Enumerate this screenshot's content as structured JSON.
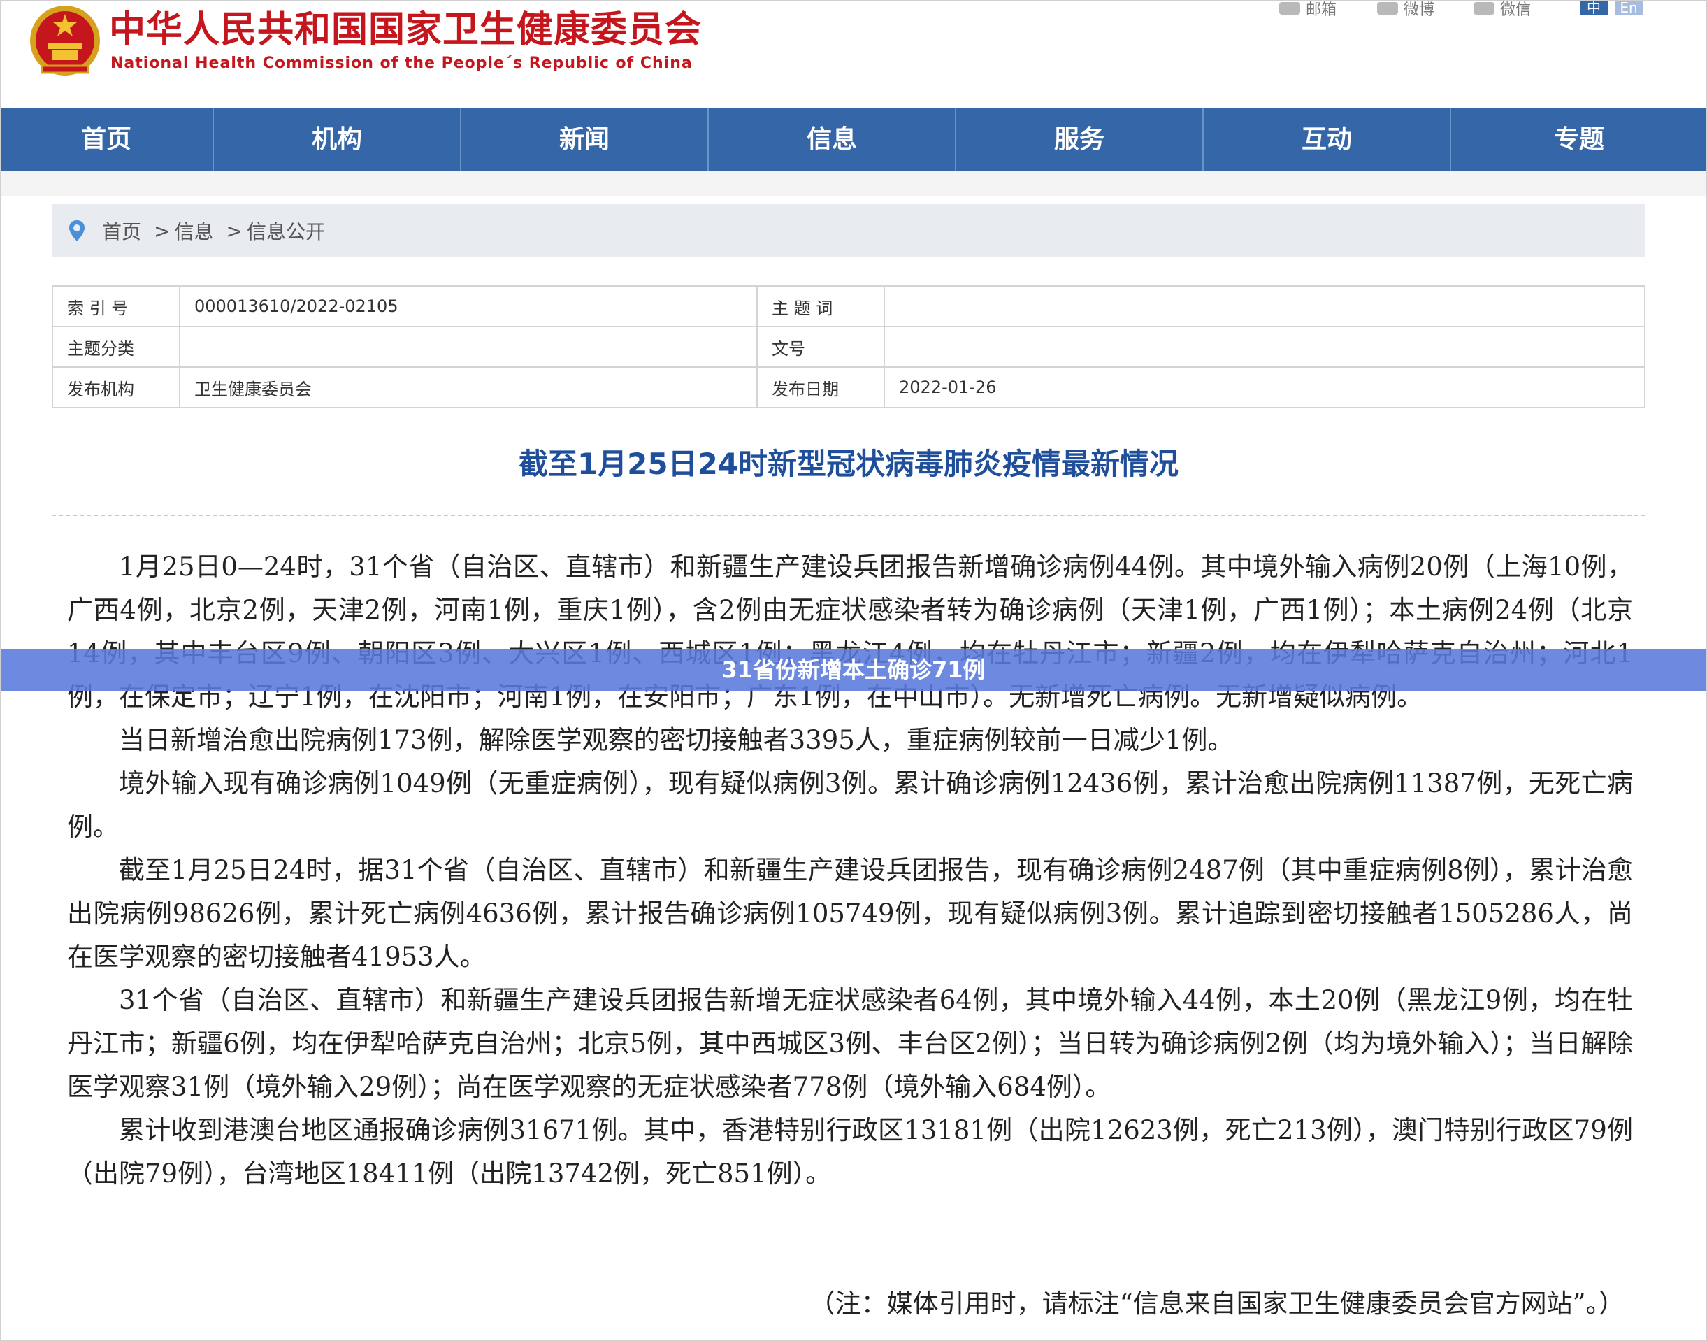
{
  "header": {
    "site_title_cn": "中华人民共和国国家卫生健康委员会",
    "site_title_en": "National Health Commission of the People´s Republic of China",
    "share_links": [
      {
        "label": "邮箱",
        "icon": "mail-icon"
      },
      {
        "label": "微博",
        "icon": "weibo-icon"
      },
      {
        "label": "微信",
        "icon": "wechat-icon"
      }
    ],
    "lang_buttons": [
      "中",
      "En"
    ]
  },
  "nav": {
    "items": [
      "首页",
      "机构",
      "新闻",
      "信息",
      "服务",
      "互动",
      "专题"
    ]
  },
  "breadcrumb": {
    "items": [
      "首页",
      "信息",
      "信息公开"
    ],
    "separator": ">"
  },
  "meta": {
    "index_label": "索 引 号",
    "index_value": "000013610/2022-02105",
    "keywords_label": "主 题 词",
    "keywords_value": "",
    "category_label": "主题分类",
    "category_value": "",
    "doc_no_label": "文号",
    "doc_no_value": "",
    "publisher_label": "发布机构",
    "publisher_value": "卫生健康委员会",
    "date_label": "发布日期",
    "date_value": "2022-01-26"
  },
  "article": {
    "title": "截至1月25日24时新型冠状病毒肺炎疫情最新情况",
    "paragraphs": [
      "1月25日0—24时，31个省（自治区、直辖市）和新疆生产建设兵团报告新增确诊病例44例。其中境外输入病例20例（上海10例，广西4例，北京2例，天津2例，河南1例，重庆1例），含2例由无症状感染者转为确诊病例（天津1例，广西1例）；本土病例24例（北京14例，其中丰台区9例、朝阳区3例、大兴区1例、西城区1例；黑龙江4例，均在牡丹江市；新疆2例，均在伊犁哈萨克自治州；河北1例，在保定市；辽宁1例，在沈阳市；河南1例，在安阳市；广东1例，在中山市）。无新增死亡病例。无新增疑似病例。",
      "当日新增治愈出院病例173例，解除医学观察的密切接触者3395人，重症病例较前一日减少1例。",
      "境外输入现有确诊病例1049例（无重症病例），现有疑似病例3例。累计确诊病例12436例，累计治愈出院病例11387例，无死亡病例。",
      "截至1月25日24时，据31个省（自治区、直辖市）和新疆生产建设兵团报告，现有确诊病例2487例（其中重症病例8例），累计治愈出院病例98626例，累计死亡病例4636例，累计报告确诊病例105749例，现有疑似病例3例。累计追踪到密切接触者1505286人，尚在医学观察的密切接触者41953人。",
      "31个省（自治区、直辖市）和新疆生产建设兵团报告新增无症状感染者64例，其中境外输入44例，本土20例（黑龙江9例，均在牡丹江市；新疆6例，均在伊犁哈萨克自治州；北京5例，其中西城区3例、丰台区2例）；当日转为确诊病例2例（均为境外输入）；当日解除医学观察31例（境外输入29例）；尚在医学观察的无症状感染者778例（境外输入684例）。",
      "累计收到港澳台地区通报确诊病例31671例。其中，香港特别行政区13181例（出院12623例，死亡213例），澳门特别行政区79例（出院79例），台湾地区18411例（出院13742例，死亡851例）。"
    ],
    "note": "（注：媒体引用时，请标注“信息来自国家卫生健康委员会官方网站”。）"
  },
  "banner": {
    "text": "31省份新增本土确诊71例"
  },
  "colors": {
    "brand_red": "#c4161c",
    "nav_blue": "#3566a8",
    "title_blue": "#1f4e9a",
    "banner_blue": "#5a7adc"
  }
}
